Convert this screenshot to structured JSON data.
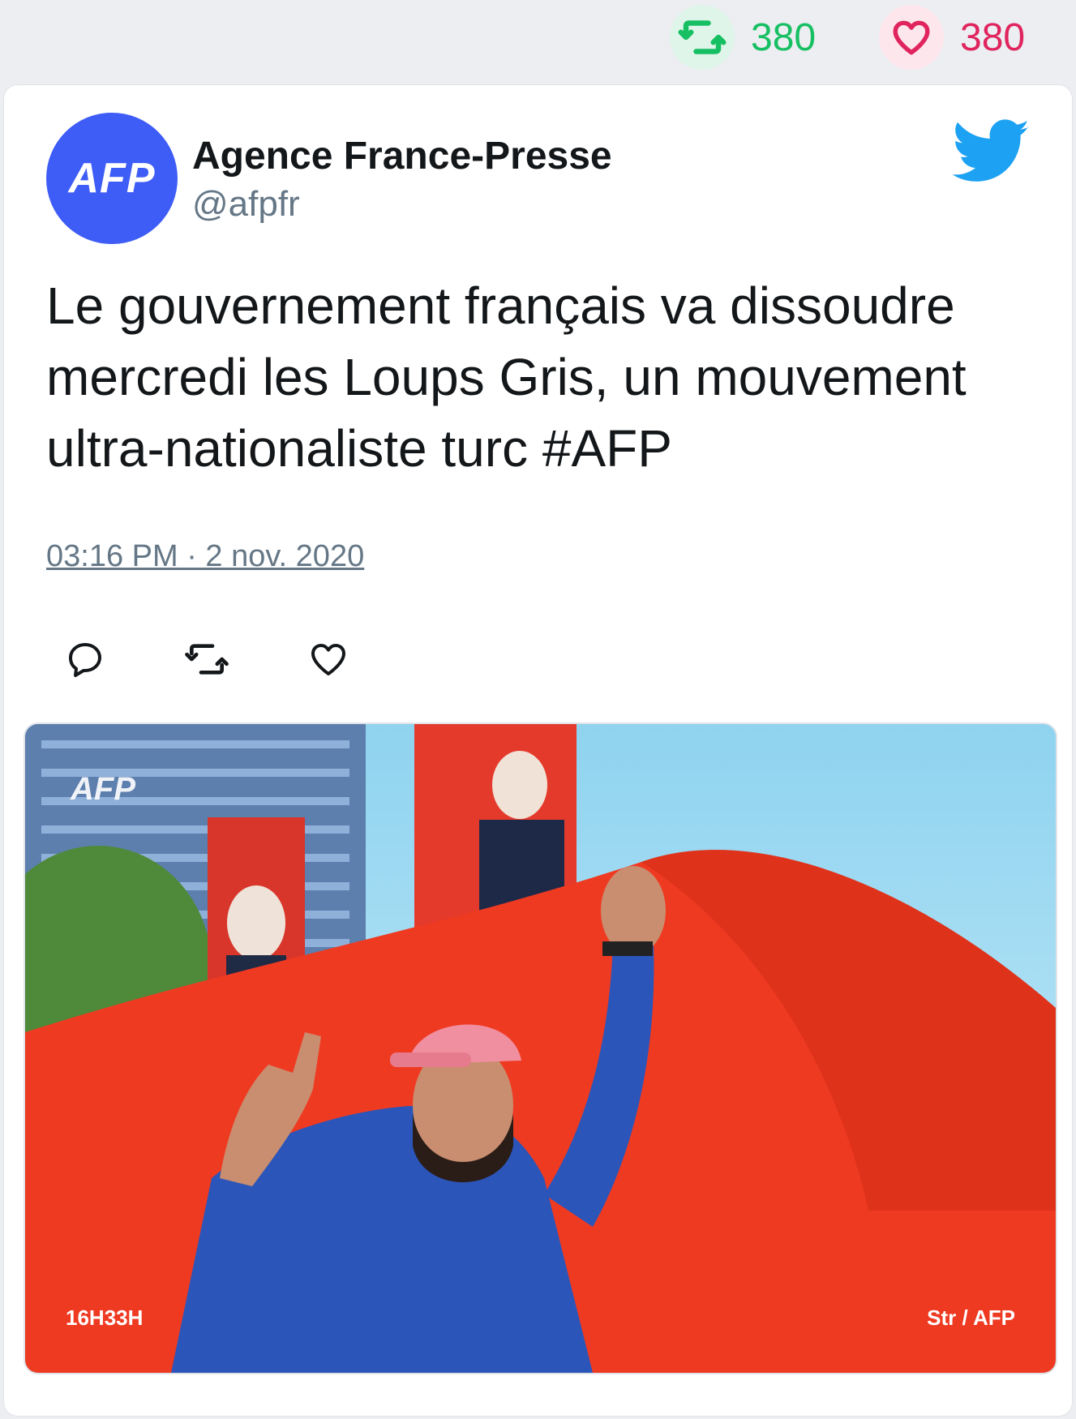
{
  "stats": {
    "retweets": "380",
    "likes": "380",
    "retweet_icon": "retweet-icon",
    "like_icon": "heart-icon",
    "retweet_color": "#17bf63",
    "like_color": "#e0245e"
  },
  "tweet": {
    "avatar_text": "AFP",
    "author_name": "Agence France-Presse",
    "handle": "@afpfr",
    "text": "Le gouvernement français va dissoudre mercredi les Loups Gris, un mouvement ultra-nationaliste turc #AFP",
    "timestamp": "03:16 PM · 2 nov. 2020",
    "brand_color": "#1da1f2",
    "avatar_color": "#3e5cf6"
  },
  "actions": [
    {
      "name": "reply",
      "icon": "reply-icon"
    },
    {
      "name": "retweet",
      "icon": "retweet-icon"
    },
    {
      "name": "like",
      "icon": "heart-icon"
    }
  ],
  "media": {
    "watermark": "AFP",
    "time_label": "16H33H",
    "credit": "Str / AFP"
  }
}
